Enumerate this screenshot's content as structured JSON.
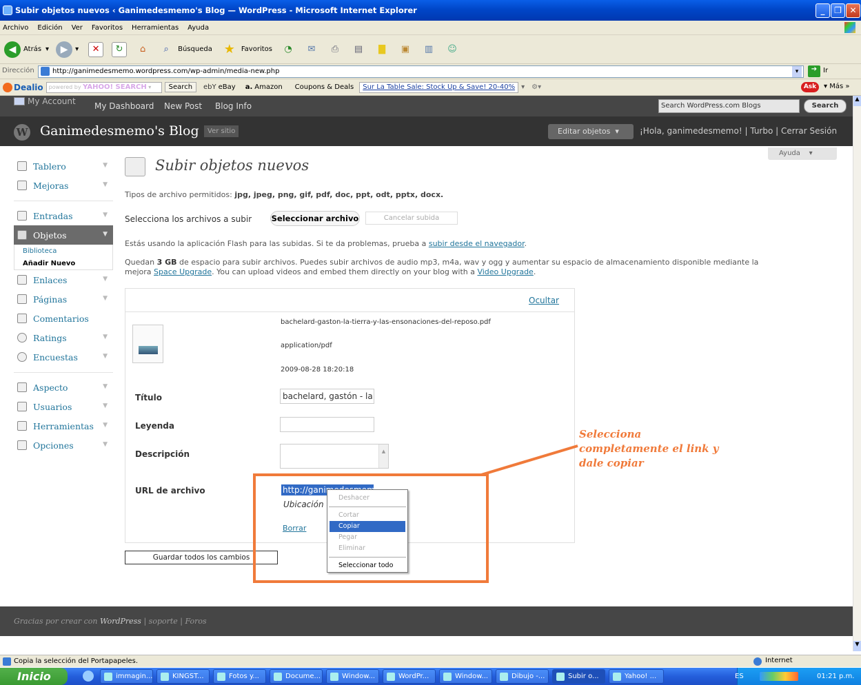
{
  "window": {
    "title": "Subir objetos nuevos ‹ Ganimedesmemo's Blog — WordPress - Microsoft Internet Explorer"
  },
  "menubar": [
    "Archivo",
    "Edición",
    "Ver",
    "Favoritos",
    "Herramientas",
    "Ayuda"
  ],
  "toolbar": {
    "back": "Atrás",
    "search": "Búsqueda",
    "favorites": "Favoritos"
  },
  "address": {
    "label": "Dirección",
    "url": "http://ganimedesmemo.wordpress.com/wp-admin/media-new.php",
    "go": "Ir"
  },
  "dealio": {
    "brand": "Dealio",
    "powered": "powered by",
    "yahoo": "YAHOO! SEARCH",
    "search_btn": "Search",
    "ebay": "eBay",
    "amazon": "Amazon",
    "coupons": "Coupons & Deals",
    "promo": "Sur La Table Sale: Stock Up & Save! 20-40%",
    "ask": "Ask",
    "more": "Más"
  },
  "wpbar": {
    "my_account": "My Account",
    "links": [
      "My Dashboard",
      "New Post",
      "Blog Info"
    ],
    "search_placeholder": "Search WordPress.com Blogs",
    "search_btn": "Search"
  },
  "header": {
    "blog": "Ganimedesmemo's Blog",
    "view_site": "Ver sitio",
    "edit_objects": "Editar objetos",
    "howdy": "¡Hola, ganimedesmemo! | Turbo | Cerrar Sesión",
    "help": "Ayuda"
  },
  "sidebar": {
    "group1": [
      "Tablero",
      "Mejoras"
    ],
    "group2": [
      "Entradas",
      "Objetos"
    ],
    "objetos_sub": [
      "Biblioteca",
      "Añadir Nuevo"
    ],
    "group3": [
      "Enlaces",
      "Páginas",
      "Comentarios",
      "Ratings",
      "Encuestas"
    ],
    "group4": [
      "Aspecto",
      "Usuarios",
      "Herramientas",
      "Opciones"
    ]
  },
  "main": {
    "title": "Subir objetos nuevos",
    "allowed_prefix": "Tipos de archivo permitidos:",
    "allowed_types": "jpg, jpeg, png, gif, pdf, doc, ppt, odt, pptx, docx.",
    "select_label": "Selecciona los archivos a subir",
    "select_btn": "Seleccionar archivo",
    "cancel_btn": "Cancelar subida",
    "flash_text": "Estás usando la aplicación Flash para las subidas. Si te da problemas, prueba a",
    "flash_link": "subir desde el navegador",
    "quota_pre": "Quedan",
    "quota_amount": "3 GB",
    "quota_line1": "de espacio para subir archivos. Puedes subir archivos de audio mp3, m4a, wav y ogg y aumentar su espacio de almacenamiento disponible mediante la",
    "quota_line2_pre": "mejora",
    "space_link": "Space Upgrade",
    "quota_line2_mid": ". You can upload videos and embed them directly on your blog with a",
    "video_link": "Video Upgrade"
  },
  "file": {
    "hide": "Ocultar",
    "name": "bachelard-gaston-la-tierra-y-las-ensonaciones-del-reposo.pdf",
    "mime": "application/pdf",
    "date": "2009-08-28 18:20:18",
    "title_label": "Título",
    "title_value": "bachelard, gastón - la",
    "caption_label": "Leyenda",
    "desc_label": "Descripción",
    "url_label": "URL de archivo",
    "url_value": "http://ganimedesmem",
    "location_text": "Ubicación d",
    "delete": "Borrar",
    "save_all": "Guardar todos los cambios"
  },
  "context_menu": [
    "Deshacer",
    "Cortar",
    "Copiar",
    "Pegar",
    "Eliminar",
    "Seleccionar todo"
  ],
  "annotation": [
    "Selecciona",
    "completamente el link y",
    "dale copiar"
  ],
  "footer": {
    "pre": "Gracias por crear con",
    "wp": "WordPress",
    "rest": "| soporte | Foros"
  },
  "status": {
    "text": "Copia la selección del Portapapeles.",
    "zone": "Internet"
  },
  "taskbar": {
    "start": "Inicio",
    "items": [
      "immagin...",
      "KINGST...",
      "Fotos y...",
      "Docume...",
      "Window...",
      "WordPr...",
      "Window...",
      "Dibujo -...",
      "Subir o...",
      "Yahoo! ..."
    ],
    "lang": "ES",
    "clock": "01:21 p.m."
  },
  "colors": {
    "annotation": "#f07a3a",
    "link": "#21759b",
    "wp_dark": "#333333",
    "selection": "#316ac5"
  }
}
